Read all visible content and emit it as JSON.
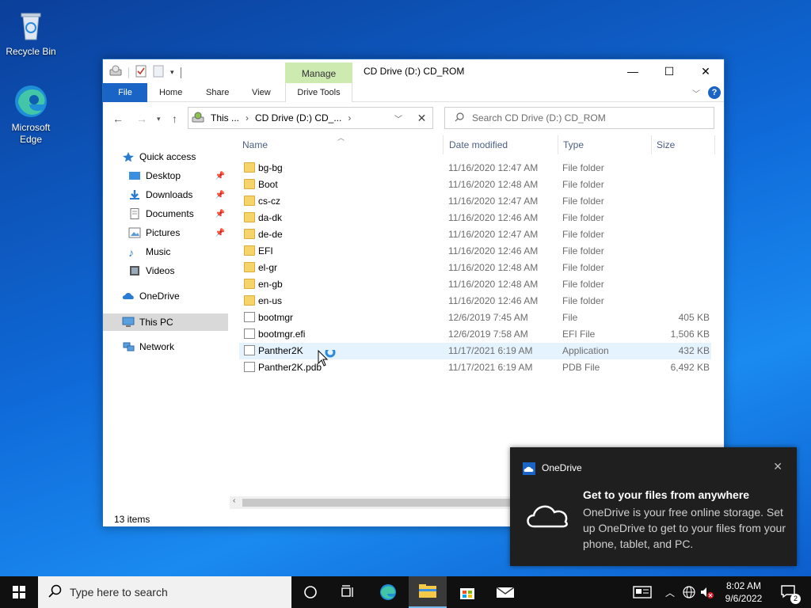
{
  "desktop": {
    "icons": [
      {
        "label": "Recycle Bin"
      },
      {
        "label": "Microsoft Edge"
      }
    ]
  },
  "window": {
    "title": "CD Drive (D:) CD_ROM",
    "manage_tab": "Manage",
    "ribbon_tabs": [
      "File",
      "Home",
      "Share",
      "View",
      "Drive Tools"
    ],
    "controls": {
      "minimize": "—",
      "maximize": "☐",
      "close": "✕"
    },
    "help": "?",
    "address": {
      "segments": [
        "This ...",
        "CD Drive (D:) CD_..."
      ]
    },
    "search": {
      "placeholder": "Search CD Drive (D:) CD_ROM"
    },
    "nav_pane": {
      "items": [
        {
          "label": "Quick access"
        },
        {
          "label": "Desktop",
          "pinned": true
        },
        {
          "label": "Downloads",
          "pinned": true
        },
        {
          "label": "Documents",
          "pinned": true
        },
        {
          "label": "Pictures",
          "pinned": true
        },
        {
          "label": "Music"
        },
        {
          "label": "Videos"
        },
        {
          "label": "OneDrive"
        },
        {
          "label": "This PC"
        },
        {
          "label": "Network"
        }
      ],
      "selected": "This PC"
    },
    "columns": [
      "Name",
      "Date modified",
      "Type",
      "Size"
    ],
    "files": [
      {
        "name": "bg-bg",
        "date": "11/16/2020 12:47 AM",
        "type": "File folder",
        "size": "",
        "kind": "folder"
      },
      {
        "name": "Boot",
        "date": "11/16/2020 12:48 AM",
        "type": "File folder",
        "size": "",
        "kind": "folder"
      },
      {
        "name": "cs-cz",
        "date": "11/16/2020 12:47 AM",
        "type": "File folder",
        "size": "",
        "kind": "folder"
      },
      {
        "name": "da-dk",
        "date": "11/16/2020 12:46 AM",
        "type": "File folder",
        "size": "",
        "kind": "folder"
      },
      {
        "name": "de-de",
        "date": "11/16/2020 12:47 AM",
        "type": "File folder",
        "size": "",
        "kind": "folder"
      },
      {
        "name": "EFI",
        "date": "11/16/2020 12:46 AM",
        "type": "File folder",
        "size": "",
        "kind": "folder"
      },
      {
        "name": "el-gr",
        "date": "11/16/2020 12:48 AM",
        "type": "File folder",
        "size": "",
        "kind": "folder"
      },
      {
        "name": "en-gb",
        "date": "11/16/2020 12:48 AM",
        "type": "File folder",
        "size": "",
        "kind": "folder"
      },
      {
        "name": "en-us",
        "date": "11/16/2020 12:46 AM",
        "type": "File folder",
        "size": "",
        "kind": "folder"
      },
      {
        "name": "bootmgr",
        "date": "12/6/2019 7:45 AM",
        "type": "File",
        "size": "405 KB",
        "kind": "file"
      },
      {
        "name": "bootmgr.efi",
        "date": "12/6/2019 7:58 AM",
        "type": "EFI File",
        "size": "1,506 KB",
        "kind": "file"
      },
      {
        "name": "Panther2K",
        "date": "11/17/2021 6:19 AM",
        "type": "Application",
        "size": "432 KB",
        "kind": "file"
      },
      {
        "name": "Panther2K.pdb",
        "date": "11/17/2021 6:19 AM",
        "type": "PDB File",
        "size": "6,492 KB",
        "kind": "file"
      }
    ],
    "hovered_row": "Panther2K",
    "status": "13 items"
  },
  "toast": {
    "app": "OneDrive",
    "heading": "Get to your files from anywhere",
    "body": "OneDrive is your free online storage. Set up OneDrive to get to your files from your phone, tablet, and PC.",
    "close": "✕"
  },
  "taskbar": {
    "search_placeholder": "Type here to search",
    "clock_time": "8:02 AM",
    "clock_date": "9/6/2022",
    "notification_count": "2"
  },
  "colors": {
    "accent": "#1a64c6",
    "manage_tab": "#cdeab1",
    "hover_row": "#e5f3ff",
    "taskbar": "#101010",
    "toast": "#1f1f1f"
  }
}
